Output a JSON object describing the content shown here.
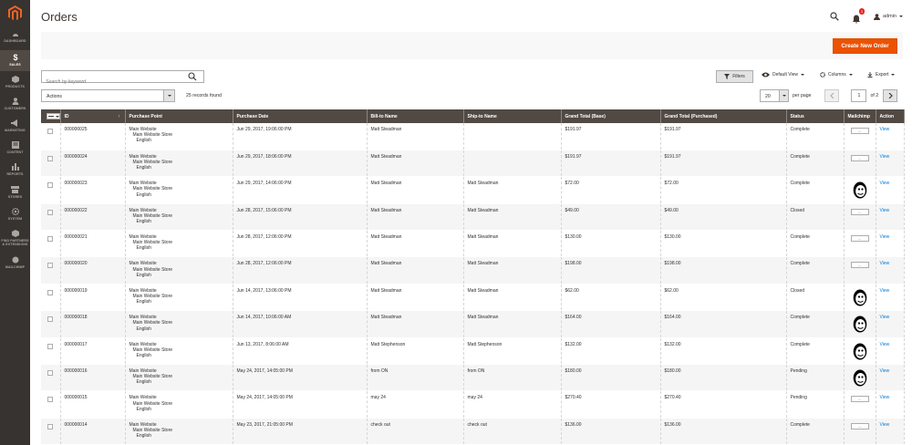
{
  "sidebar": {
    "items": [
      {
        "label": "DASHBOARD",
        "icon": "dashboard-icon"
      },
      {
        "label": "SALES",
        "icon": "dollar-icon"
      },
      {
        "label": "PRODUCTS",
        "icon": "cube-icon"
      },
      {
        "label": "CUSTOMERS",
        "icon": "customers-icon"
      },
      {
        "label": "MARKETING",
        "icon": "megaphone-icon"
      },
      {
        "label": "CONTENT",
        "icon": "content-icon"
      },
      {
        "label": "REPORTS",
        "icon": "bar-chart-icon"
      },
      {
        "label": "STORES",
        "icon": "store-icon"
      },
      {
        "label": "SYSTEM",
        "icon": "gear-icon"
      },
      {
        "label": "FIND PARTNERS",
        "label2": "& EXTENSIONS",
        "icon": "partners-icon"
      },
      {
        "label": "MAILCHIMP",
        "icon": "mailchimp-icon"
      }
    ]
  },
  "header": {
    "title": "Orders",
    "notifications": "3",
    "user": "admin"
  },
  "page_actions": {
    "create_label": "Create New Order"
  },
  "toolbar": {
    "search_placeholder": "Search by keyword",
    "filters_label": "Filters",
    "view_label": "Default View",
    "columns_label": "Columns",
    "export_label": "Export",
    "actions_label": "Actions",
    "records_found": "25 records found",
    "per_page_value": "20",
    "per_page_label": "per page",
    "page_current": "1",
    "page_total": "of 2"
  },
  "grid": {
    "columns": [
      "ID",
      "Purchase Point",
      "Purchase Date",
      "Bill-to Name",
      "Ship-to Name",
      "Grand Total (Base)",
      "Grand Total (Purchased)",
      "Status",
      "Mailchimp",
      "Action"
    ],
    "rows": [
      {
        "id": "000000025",
        "pp": [
          "Main Website",
          "Main Website Store",
          "English"
        ],
        "date": "Jun 29, 2017, 19:06:00 PM",
        "bill": "Matt Steadman",
        "ship": "",
        "base": "$191.97",
        "purchased": "$191.97",
        "status": "Complete",
        "mc": "...",
        "action": "View"
      },
      {
        "id": "000000024",
        "pp": [
          "Main Website",
          "Main Website Store",
          "English"
        ],
        "date": "Jun 29, 2017, 18:06:00 PM",
        "bill": "Matt Steadman",
        "ship": "",
        "base": "$191.97",
        "purchased": "$191.97",
        "status": "Complete",
        "mc": "...",
        "action": "View"
      },
      {
        "id": "000000023",
        "pp": [
          "Main Website",
          "Main Website Store",
          "English"
        ],
        "date": "Jun 29, 2017, 14:06:00 PM",
        "bill": "Matt Steadman",
        "ship": "Matt Steadman",
        "base": "$72.00",
        "purchased": "$72.00",
        "status": "Complete",
        "mc": "",
        "action": "View"
      },
      {
        "id": "000000022",
        "pp": [
          "Main Website",
          "Main Website Store",
          "English"
        ],
        "date": "Jun 28, 2017, 15:06:00 PM",
        "bill": "Matt Steadman",
        "ship": "Matt Steadman",
        "base": "$49.00",
        "purchased": "$49.00",
        "status": "Closed",
        "mc": "...",
        "action": "View"
      },
      {
        "id": "000000021",
        "pp": [
          "Main Website",
          "Main Website Store",
          "English"
        ],
        "date": "Jun 28, 2017, 12:06:00 PM",
        "bill": "Matt Steadman",
        "ship": "Matt Steadman",
        "base": "$130.00",
        "purchased": "$130.00",
        "status": "Complete",
        "mc": "...",
        "action": "View"
      },
      {
        "id": "000000020",
        "pp": [
          "Main Website",
          "Main Website Store",
          "English"
        ],
        "date": "Jun 28, 2017, 12:06:00 PM",
        "bill": "Matt Steadman",
        "ship": "Matt Steadman",
        "base": "$198.00",
        "purchased": "$198.00",
        "status": "Complete",
        "mc": "...",
        "action": "View"
      },
      {
        "id": "000000019",
        "pp": [
          "Main Website",
          "Main Website Store",
          "English"
        ],
        "date": "Jun 14, 2017, 13:06:00 PM",
        "bill": "Matt Steadman",
        "ship": "Matt Steadman",
        "base": "$62.00",
        "purchased": "$62.00",
        "status": "Closed",
        "mc": "",
        "action": "View"
      },
      {
        "id": "000000018",
        "pp": [
          "Main Website",
          "Main Website Store",
          "English"
        ],
        "date": "Jun 14, 2017, 10:06:00 AM",
        "bill": "Matt Steadman",
        "ship": "Matt Steadman",
        "base": "$164.00",
        "purchased": "$164.00",
        "status": "Complete",
        "mc": "",
        "action": "View"
      },
      {
        "id": "000000017",
        "pp": [
          "Main Website",
          "Main Website Store",
          "English"
        ],
        "date": "Jun 13, 2017, 8:06:00 AM",
        "bill": "Matt Stephenson",
        "ship": "Matt Stephenson",
        "base": "$132.00",
        "purchased": "$132.00",
        "status": "Complete",
        "mc": "",
        "action": "View"
      },
      {
        "id": "000000016",
        "pp": [
          "Main Website",
          "Main Website Store",
          "English"
        ],
        "date": "May 24, 2017, 14:05:00 PM",
        "bill": "from ON",
        "ship": "from ON",
        "base": "$180.00",
        "purchased": "$180.00",
        "status": "Pending",
        "mc": "",
        "action": "View"
      },
      {
        "id": "000000015",
        "pp": [
          "Main Website",
          "Main Website Store",
          "English"
        ],
        "date": "May 24, 2017, 14:05:00 PM",
        "bill": "may 24",
        "ship": "may 24",
        "base": "$270.40",
        "purchased": "$270.40",
        "status": "Pending",
        "mc": "...",
        "action": "View"
      },
      {
        "id": "000000014",
        "pp": [
          "Main Website",
          "Main Website Store",
          "English"
        ],
        "date": "May 23, 2017, 21:05:00 PM",
        "bill": "check out",
        "ship": "check out",
        "base": "$136.00",
        "purchased": "$136.00",
        "status": "Complete",
        "mc": "...",
        "action": "View"
      }
    ]
  }
}
